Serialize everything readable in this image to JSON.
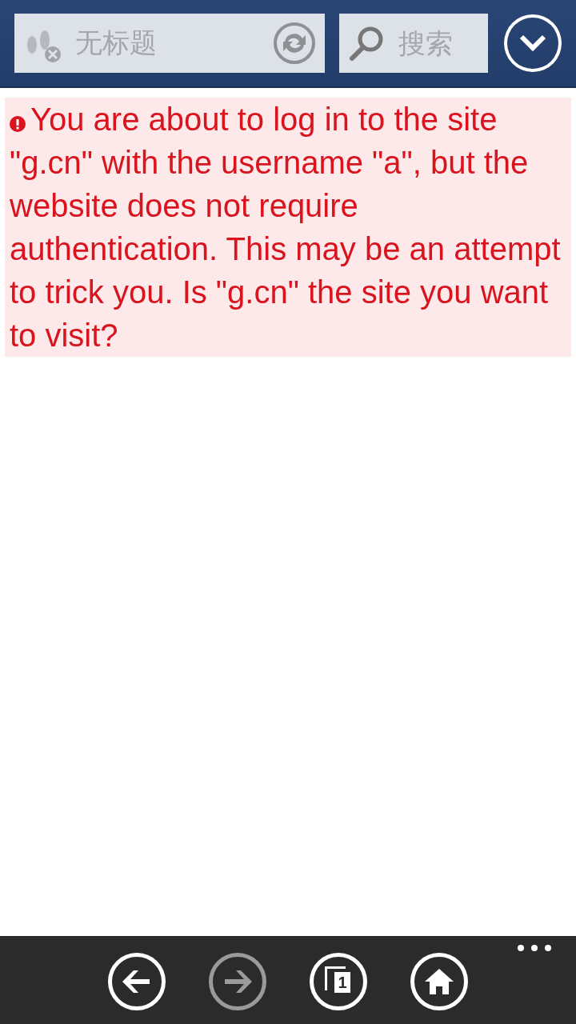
{
  "address_bar": {
    "title": "无标题"
  },
  "search": {
    "placeholder": "搜索"
  },
  "warning": {
    "message": "You are about to log in to the site \"g.cn\" with the username \"a\", but the website does not require authentication. This may be an attempt to trick you. Is \"g.cn\" the site you want to visit?"
  },
  "app_bar": {
    "buttons": [
      {
        "kind": "back",
        "disabled": false
      },
      {
        "kind": "forward",
        "disabled": true
      },
      {
        "kind": "tabs",
        "count": "1",
        "disabled": false
      },
      {
        "kind": "home",
        "disabled": false
      }
    ]
  }
}
